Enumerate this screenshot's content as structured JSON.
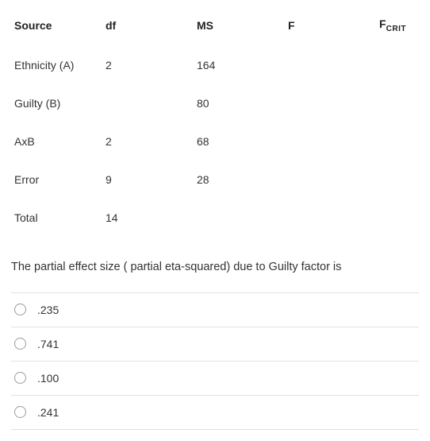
{
  "table": {
    "headers": {
      "source": "Source",
      "df": "df",
      "ms": "MS",
      "f": "F",
      "fcrit_main": "F",
      "fcrit_sub": "CRIT"
    },
    "rows": [
      {
        "source": "Ethnicity (A)",
        "df": "2",
        "ms": "164",
        "f": "",
        "fcrit": ""
      },
      {
        "source": "Guilty (B)",
        "df": "",
        "ms": "80",
        "f": "",
        "fcrit": ""
      },
      {
        "source": "AxB",
        "df": "2",
        "ms": "68",
        "f": "",
        "fcrit": ""
      },
      {
        "source": "Error",
        "df": "9",
        "ms": "28",
        "f": "",
        "fcrit": ""
      },
      {
        "source": "Total",
        "df": "14",
        "ms": "",
        "f": "",
        "fcrit": ""
      }
    ]
  },
  "question": "The partial effect size ( partial eta-squared) due to Guilty factor is",
  "options": [
    {
      "label": ".235"
    },
    {
      "label": ".741"
    },
    {
      "label": ".100"
    },
    {
      "label": ".241"
    }
  ]
}
